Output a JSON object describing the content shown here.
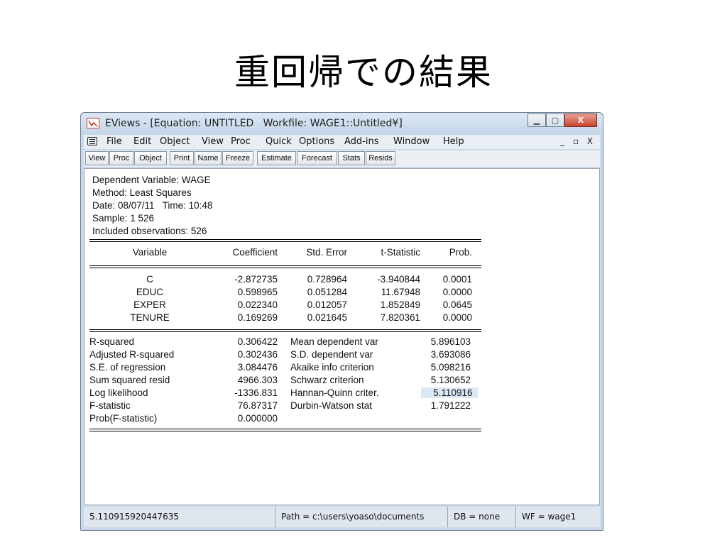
{
  "slide": {
    "title": "重回帰での結果"
  },
  "window": {
    "title": "EViews - [Equation: UNTITLED   Workfile: WAGE1::Untitled¥]",
    "controls": {
      "minimize": "▁",
      "maximize": "▢",
      "close": "X"
    }
  },
  "menubar": {
    "items": [
      "File",
      "Edit",
      "Object",
      "View",
      "Proc",
      "Quick",
      "Options",
      "Add-ins",
      "Window",
      "Help"
    ],
    "mdi_controls": "_ ▫ X"
  },
  "toolbar": {
    "buttons": [
      "View",
      "Proc",
      "Object",
      "Print",
      "Name",
      "Freeze",
      "Estimate",
      "Forecast",
      "Stats",
      "Resids"
    ]
  },
  "output": {
    "header_lines": [
      "Dependent Variable: WAGE",
      "Method: Least Squares",
      "Date: 08/07/11   Time: 10:48",
      "Sample: 1 526",
      "Included observations: 526"
    ],
    "columns": [
      "Variable",
      "Coefficient",
      "Std. Error",
      "t-Statistic",
      "Prob."
    ],
    "rows": [
      [
        "C",
        "-2.872735",
        "0.728964",
        "-3.940844",
        "0.0001"
      ],
      [
        "EDUC",
        "0.598965",
        "0.051284",
        "11.67948",
        "0.0000"
      ],
      [
        "EXPER",
        "0.022340",
        "0.012057",
        "1.852849",
        "0.0645"
      ],
      [
        "TENURE",
        "0.169269",
        "0.021645",
        "7.820361",
        "0.0000"
      ]
    ],
    "stats_left": [
      [
        "R-squared",
        "0.306422"
      ],
      [
        "Adjusted R-squared",
        "0.302436"
      ],
      [
        "S.E. of regression",
        "3.084476"
      ],
      [
        "Sum squared resid",
        "4966.303"
      ],
      [
        "Log likelihood",
        "-1336.831"
      ],
      [
        "F-statistic",
        "76.87317"
      ],
      [
        "Prob(F-statistic)",
        "0.000000"
      ]
    ],
    "stats_right": [
      [
        "Mean dependent var",
        "5.896103"
      ],
      [
        "S.D. dependent var",
        "3.693086"
      ],
      [
        "Akaike info criterion",
        "5.098216"
      ],
      [
        "Schwarz criterion",
        "5.130652"
      ],
      [
        "Hannan-Quinn criter.",
        "5.110916"
      ],
      [
        "Durbin-Watson stat",
        "1.791222"
      ]
    ]
  },
  "statusbar": {
    "value": "5.110915920447635",
    "path": "Path = c:\\users\\yoaso\\documents",
    "db": "DB = none",
    "wf": "WF = wage1"
  },
  "colors": {
    "highlight": "#dce8f5",
    "titlebar": "#c5d6e9",
    "close": "#c8412a"
  }
}
